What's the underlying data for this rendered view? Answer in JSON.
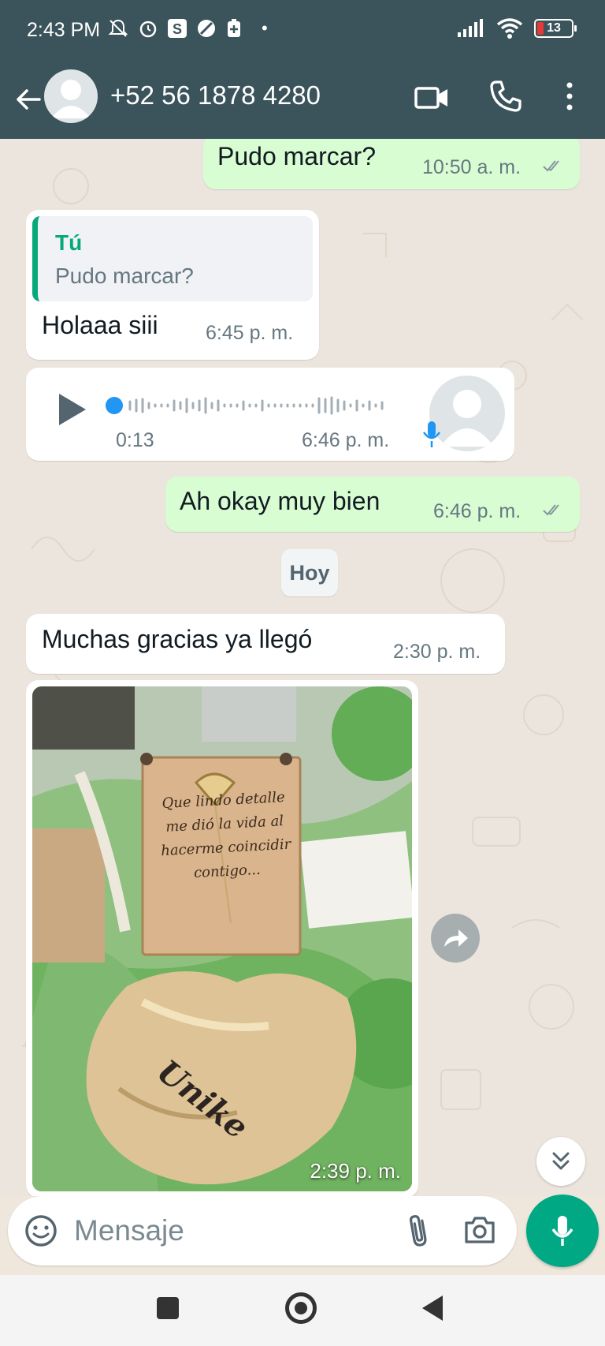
{
  "status_bar": {
    "time": "2:43 PM",
    "battery": "13"
  },
  "header": {
    "contact": "+52 56 1878 4280"
  },
  "messages": {
    "m1": {
      "text": "Pudo marcar?",
      "time": "10:50 a. m."
    },
    "m2": {
      "quote_author": "Tú",
      "quote_text": "Pudo marcar?",
      "text": "Holaaa siii",
      "time": "6:45 p. m."
    },
    "m3": {
      "duration": "0:13",
      "time": "6:46 p. m."
    },
    "m4": {
      "text": "Ah okay muy bien",
      "time": "6:46 p. m."
    },
    "m5": {
      "text": "Muchas gracias ya llegó",
      "time": "2:30 p. m."
    },
    "m6": {
      "time": "2:39 p. m.",
      "box_text": [
        "Que lindo detalle",
        "me dió la vida al",
        "hacerme coincidir",
        "contigo..."
      ],
      "brand": "Unike"
    }
  },
  "day_chip": "Hoy",
  "input": {
    "placeholder": "Mensaje"
  },
  "colors": {
    "header": "#3b535b",
    "outgoing": "#d9fdd3",
    "incoming": "#ffffff",
    "accent": "#00a884",
    "quote_bar": "#06a87c"
  },
  "icons": [
    "back-arrow-icon",
    "video-call-icon",
    "phone-icon",
    "more-vertical-icon",
    "play-icon",
    "mic-icon",
    "forward-icon",
    "chevron-double-down-icon",
    "emoji-icon",
    "paperclip-icon",
    "camera-icon"
  ]
}
